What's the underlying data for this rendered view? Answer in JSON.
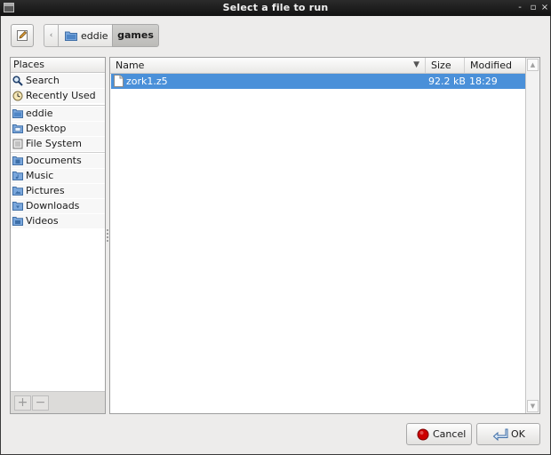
{
  "window": {
    "title": "Select a file to run",
    "controls": [
      "-",
      "▫",
      "×"
    ]
  },
  "pathbar": {
    "back_arrow": "‹",
    "segments": [
      {
        "label": "eddie",
        "icon": "home-folder-icon"
      },
      {
        "label": "games",
        "active": true
      }
    ]
  },
  "places": {
    "header": "Places",
    "items": [
      {
        "label": "Search",
        "icon": "search-icon"
      },
      {
        "label": "Recently Used",
        "icon": "clock-icon"
      },
      {
        "label": "eddie",
        "icon": "home-folder-icon"
      },
      {
        "label": "Desktop",
        "icon": "desktop-folder-icon"
      },
      {
        "label": "File System",
        "icon": "drive-icon"
      },
      {
        "label": "Documents",
        "icon": "folder-icon"
      },
      {
        "label": "Music",
        "icon": "folder-icon"
      },
      {
        "label": "Pictures",
        "icon": "folder-icon"
      },
      {
        "label": "Downloads",
        "icon": "folder-icon"
      },
      {
        "label": "Videos",
        "icon": "folder-icon"
      }
    ],
    "add_label": "+",
    "remove_label": "−"
  },
  "files": {
    "columns": {
      "name": "Name",
      "size": "Size",
      "modified": "Modified"
    },
    "rows": [
      {
        "name": "zork1.z5",
        "size": "92.2 kB",
        "modified": "18:29",
        "selected": true
      }
    ]
  },
  "buttons": {
    "cancel": "Cancel",
    "ok": "OK"
  },
  "colors": {
    "selection": "#4a90d9",
    "folder": "#5b8fc9",
    "cancel_icon": "#cc0000"
  }
}
